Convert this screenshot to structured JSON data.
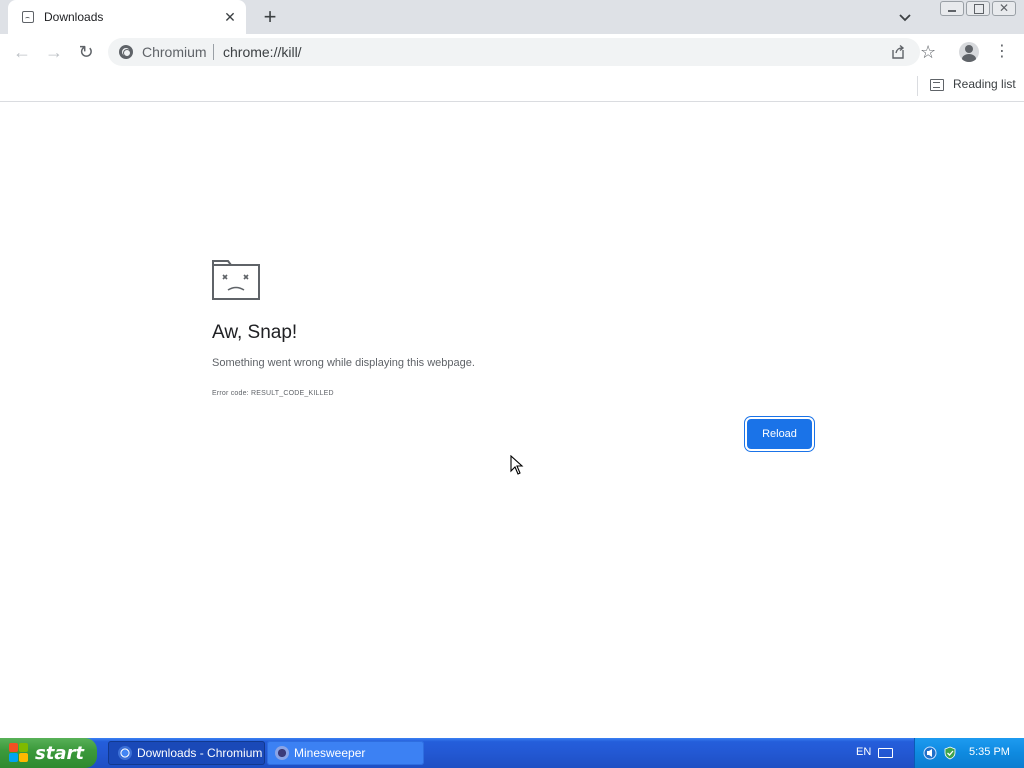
{
  "browser": {
    "tab": {
      "title": "Downloads",
      "close_glyph": "✕"
    },
    "new_tab_glyph": "+",
    "window_controls": {
      "close_glyph": "✕"
    },
    "toolbar": {
      "back_glyph": "←",
      "forward_glyph": "→",
      "reload_glyph": "↻",
      "star_glyph": "☆",
      "menu_glyph": "⋮"
    },
    "omnibox": {
      "origin": "Chromium",
      "url": "chrome://kill/"
    },
    "bookmarks_bar": {
      "reading_list_label": "Reading list"
    }
  },
  "page": {
    "title": "Aw, Snap!",
    "message": "Something went wrong while displaying this webpage.",
    "error_code": "Error code: RESULT_CODE_KILLED",
    "reload_label": "Reload"
  },
  "taskbar": {
    "start_label": "start",
    "items": [
      {
        "label": "Downloads - Chromium",
        "icon": "chromium-icon",
        "active": true
      },
      {
        "label": "Minesweeper",
        "icon": "minesweeper-icon",
        "active": false
      }
    ],
    "language": "EN",
    "clock": "5:35 PM"
  },
  "colors": {
    "accent": "#1a73e8",
    "taskbar": "#245edb",
    "start": "#3c9a3c",
    "tray": "#0f8ae0"
  }
}
